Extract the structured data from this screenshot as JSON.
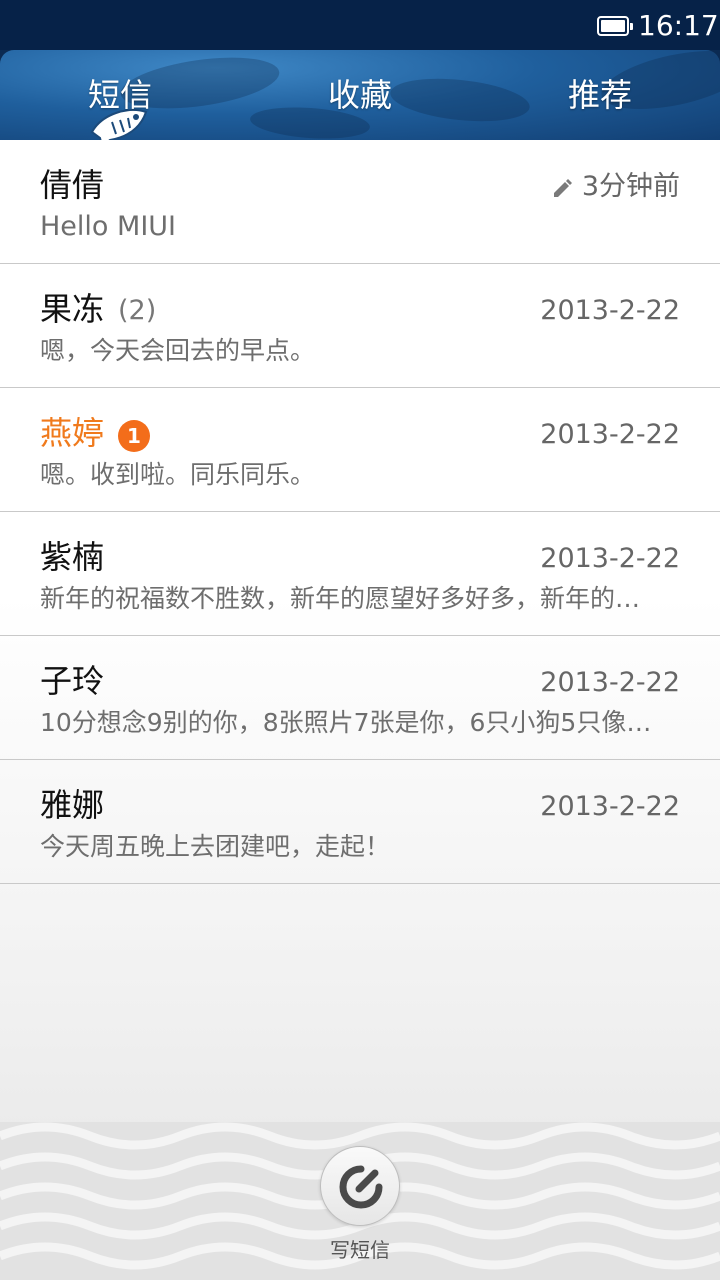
{
  "status_bar": {
    "time": "16:17",
    "battery_icon": "battery-full-icon"
  },
  "tabs": [
    {
      "label": "短信",
      "active": true
    },
    {
      "label": "收藏",
      "active": false
    },
    {
      "label": "推荐",
      "active": false
    }
  ],
  "conversations": [
    {
      "name": "倩倩",
      "count": "",
      "unread_badge": "",
      "time": "3分钟前",
      "draft_icon": "pencil-icon",
      "snippet": "Hello MIUI"
    },
    {
      "name": "果冻",
      "count": "(2)",
      "unread_badge": "",
      "time": "2013-2-22",
      "snippet": "嗯，今天会回去的早点。"
    },
    {
      "name": "燕婷",
      "count": "",
      "unread_badge": "1",
      "time": "2013-2-22",
      "snippet": "嗯。收到啦。同乐同乐。"
    },
    {
      "name": "紫楠",
      "count": "",
      "unread_badge": "",
      "time": "2013-2-22",
      "snippet": "新年的祝福数不胜数，新年的愿望好多好多，新年的…"
    },
    {
      "name": "子玲",
      "count": "",
      "unread_badge": "",
      "time": "2013-2-22",
      "snippet": "10分想念9别的你，8张照片7张是你，6只小狗5只像…"
    },
    {
      "name": "雅娜",
      "count": "",
      "unread_badge": "",
      "time": "2013-2-22",
      "snippet": "今天周五晚上去团建吧，走起！"
    }
  ],
  "compose": {
    "label": "写短信",
    "icon": "compose-icon"
  },
  "colors": {
    "unread_name": "#f07a1c",
    "badge": "#f36d1a",
    "header": "#1f5f9d",
    "status_bar": "#062248"
  }
}
